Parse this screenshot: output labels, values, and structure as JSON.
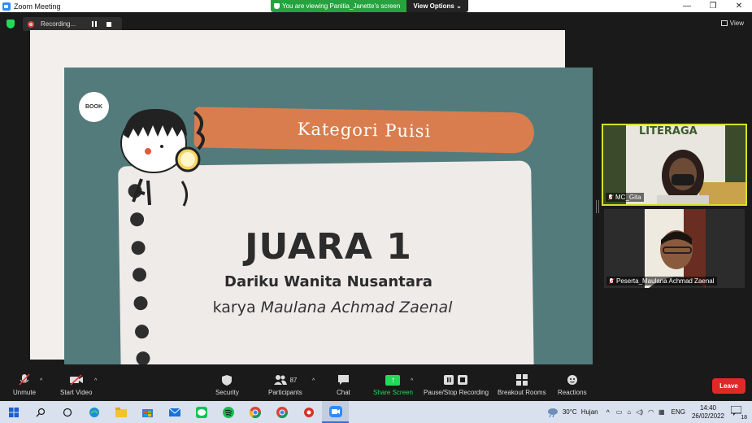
{
  "window": {
    "title": "Zoom Meeting",
    "controls": [
      "—",
      "❐",
      "✕"
    ]
  },
  "banner": {
    "viewing": "You are viewing Panitia_Janette's screen",
    "view_options": "View Options ⌄"
  },
  "recording": {
    "label": "Recording..."
  },
  "view_button": "View",
  "slide": {
    "logo": "BOOK",
    "category": "Kategori Puisi",
    "rank": "JUARA 1",
    "work_title": "Dariku Wanita Nusantara",
    "author_prefix": "karya",
    "author": "Maulana Achmad Zaenal"
  },
  "participants_panel": [
    {
      "name": "MC_Gita",
      "overlay_text": "LITERAGA",
      "muted": true
    },
    {
      "name": "Peserta_Maulana Achmad Zaenal",
      "muted": true
    }
  ],
  "toolbar": {
    "unmute": "Unmute",
    "start_video": "Start Video",
    "security": "Security",
    "participants": "Participants",
    "participants_count": "87",
    "chat": "Chat",
    "share_screen": "Share Screen",
    "recording_ctrl": "Pause/Stop Recording",
    "breakout": "Breakout Rooms",
    "reactions": "Reactions",
    "leave": "Leave"
  },
  "taskbar": {
    "weather_temp": "30°C",
    "weather_desc": "Hujan",
    "language": "ENG",
    "time": "14:40",
    "date": "26/02/2022",
    "notifications": "18"
  },
  "colors": {
    "slide_teal": "#537b7c",
    "banner_orange": "#d97d4e",
    "speaker_border": "#d8e026",
    "share_green": "#23d959",
    "leave_red": "#e02828"
  }
}
